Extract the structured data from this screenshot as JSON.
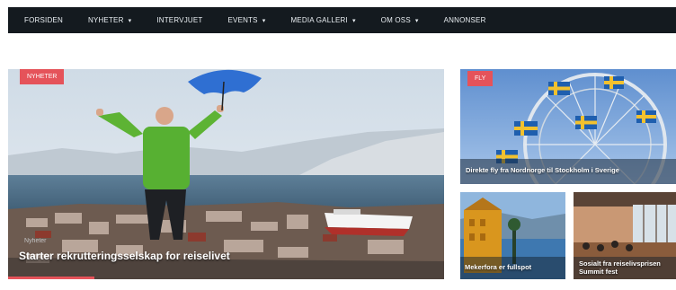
{
  "nav": {
    "items": [
      {
        "label": "FORSIDEN",
        "dropdown": false
      },
      {
        "label": "NYHETER",
        "dropdown": true
      },
      {
        "label": "INTERVJUET",
        "dropdown": false
      },
      {
        "label": "EVENTS",
        "dropdown": true
      },
      {
        "label": "MEDIA GALLERI",
        "dropdown": true
      },
      {
        "label": "OM OSS",
        "dropdown": true
      },
      {
        "label": "ANNONSER",
        "dropdown": false
      }
    ]
  },
  "colors": {
    "nav_bg": "#141a1f",
    "badge": "#e5535a",
    "page_bg": "#ffffff"
  },
  "featured": {
    "badge": "NYHETER",
    "tag": "Nyheter",
    "title": "Starter rekrutteringsselskap for reiselivet"
  },
  "side_top": {
    "badge": "FLY",
    "title": "Direkte fly fra Nordnorge til Stockholm i Sverige"
  },
  "side_bottom_left": {
    "title": "Mekerfora er fullspot"
  },
  "side_bottom_right": {
    "title": "Sosialt fra reiselivsprisen Summit fest"
  },
  "icons": {
    "dropdown": "chevron-down-icon"
  }
}
